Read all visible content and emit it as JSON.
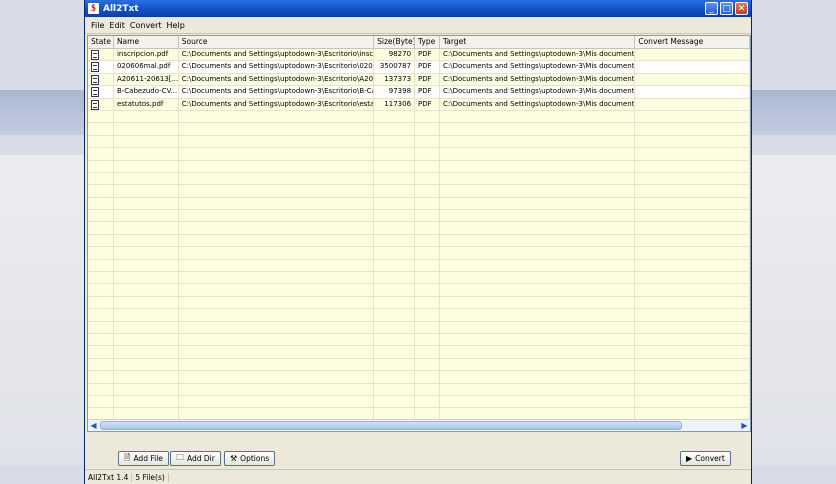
{
  "window": {
    "title": "All2Txt"
  },
  "menu": [
    "File",
    "Edit",
    "Convert",
    "Help"
  ],
  "columns": [
    "State",
    "Name",
    "Source",
    "Size(Byte)",
    "Type",
    "Target",
    "Convert Message"
  ],
  "rows": [
    {
      "name": "inscripcion.pdf",
      "source": "C:\\Documents and Settings\\uptodown-3\\Escritorio\\inscrip...",
      "size": "98270",
      "type": "PDF",
      "target": "C:\\Documents and Settings\\uptodown-3\\Mis documentosi...",
      "message": ""
    },
    {
      "name": "020606mal.pdf",
      "source": "C:\\Documents and Settings\\uptodown-3\\Escritorio\\02060...",
      "size": "3500787",
      "type": "PDF",
      "target": "C:\\Documents and Settings\\uptodown-3\\Mis documentos...",
      "message": ""
    },
    {
      "name": "A20611-20613[...",
      "source": "C:\\Documents and Settings\\uptodown-3\\Escritorio\\A2061...",
      "size": "137373",
      "type": "PDF",
      "target": "C:\\Documents and Settings\\uptodown-3\\Mis documentos...",
      "message": ""
    },
    {
      "name": "B-Cabezudo-CV...",
      "source": "C:\\Documents and Settings\\uptodown-3\\Escritorio\\B-Cab...",
      "size": "97398",
      "type": "PDF",
      "target": "C:\\Documents and Settings\\uptodown-3\\Mis documentos...",
      "message": ""
    },
    {
      "name": "estatutos.pdf",
      "source": "C:\\Documents and Settings\\uptodown-3\\Escritorio\\estatu...",
      "size": "117306",
      "type": "PDF",
      "target": "C:\\Documents and Settings\\uptodown-3\\Mis documentos...",
      "message": ""
    }
  ],
  "buttons": {
    "add_file": "Add File",
    "add_dir": "Add Dir",
    "options": "Options",
    "convert": "Convert"
  },
  "status": {
    "version": "All2Txt 1.4",
    "count": "5 File(s)"
  },
  "colors": {
    "list_bg": "#fdfde0",
    "titlebar": "#0f4fc4"
  }
}
